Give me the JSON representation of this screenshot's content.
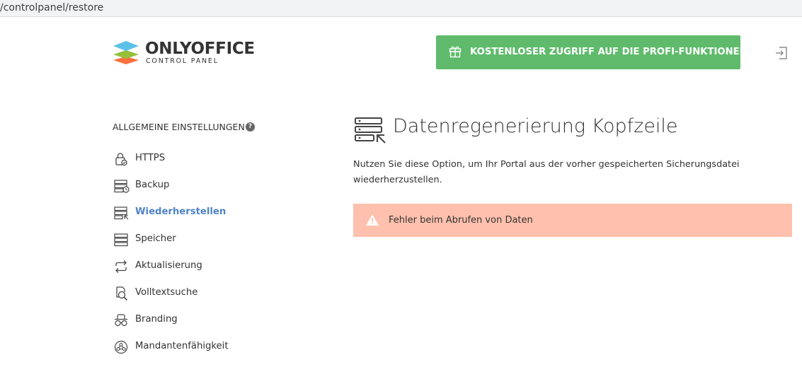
{
  "browser": {
    "url": "/controlpanel/restore"
  },
  "header": {
    "logo_brand": "ONLYOFFICE",
    "logo_sub": "CONTROL PANEL",
    "promo_button_label": "KOSTENLOSER ZUGRIFF AUF DIE PROFI-FUNKTIONEN",
    "promo_icon": "gift-icon",
    "logout_icon": "logout-icon"
  },
  "sidebar": {
    "section_title": "ALLGEMEINE EINSTELLUNGEN",
    "help_glyph": "?",
    "items": [
      {
        "label": "HTTPS",
        "icon": "lock-icon",
        "active": false
      },
      {
        "label": "Backup",
        "icon": "backup-icon",
        "active": false
      },
      {
        "label": "Wiederherstellen",
        "icon": "restore-icon",
        "active": true
      },
      {
        "label": "Speicher",
        "icon": "storage-icon",
        "active": false
      },
      {
        "label": "Aktualisierung",
        "icon": "update-icon",
        "active": false
      },
      {
        "label": "Volltextsuche",
        "icon": "fulltext-search-icon",
        "active": false
      },
      {
        "label": "Branding",
        "icon": "branding-icon",
        "active": false
      },
      {
        "label": "Mandantenfähigkeit",
        "icon": "multitenancy-icon",
        "active": false
      }
    ]
  },
  "main": {
    "title": "Datenregenerierung Kopfzeile",
    "description": "Nutzen Sie diese Option, um Ihr Portal aus der vorher gespeicherten Sicherungsdatei wiederherzustellen.",
    "error_message": "Fehler beim Abrufen von Daten"
  },
  "colors": {
    "accent_green": "#5fbb6b",
    "active_link": "#5083c7",
    "error_background": "#ffc0ad"
  }
}
